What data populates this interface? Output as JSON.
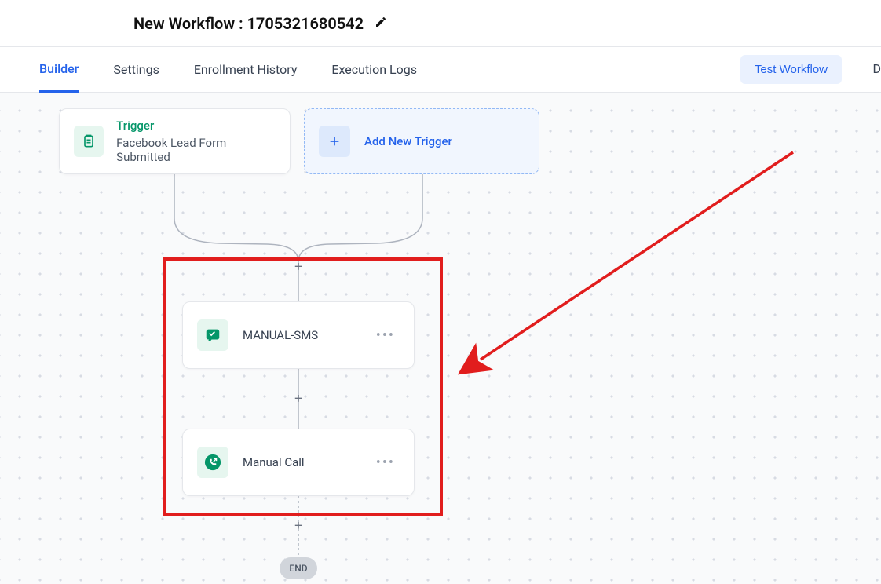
{
  "header": {
    "title": "New Workflow : 1705321680542"
  },
  "nav": {
    "tabs": {
      "builder": "Builder",
      "settings": "Settings",
      "enrollment": "Enrollment History",
      "execution": "Execution Logs"
    },
    "test_button": "Test Workflow",
    "cropped": "D"
  },
  "trigger": {
    "label": "Trigger",
    "subtitle": "Facebook Lead Form Submitted"
  },
  "add_trigger": {
    "label": "Add New Trigger"
  },
  "actions": {
    "sms": {
      "label": "MANUAL-SMS"
    },
    "call": {
      "label": "Manual Call"
    }
  },
  "end_label": "END",
  "icons": {
    "clipboard": "clipboard-icon",
    "plus": "plus-icon",
    "sms": "sms-icon",
    "call": "call-icon",
    "pencil": "pencil-icon"
  }
}
